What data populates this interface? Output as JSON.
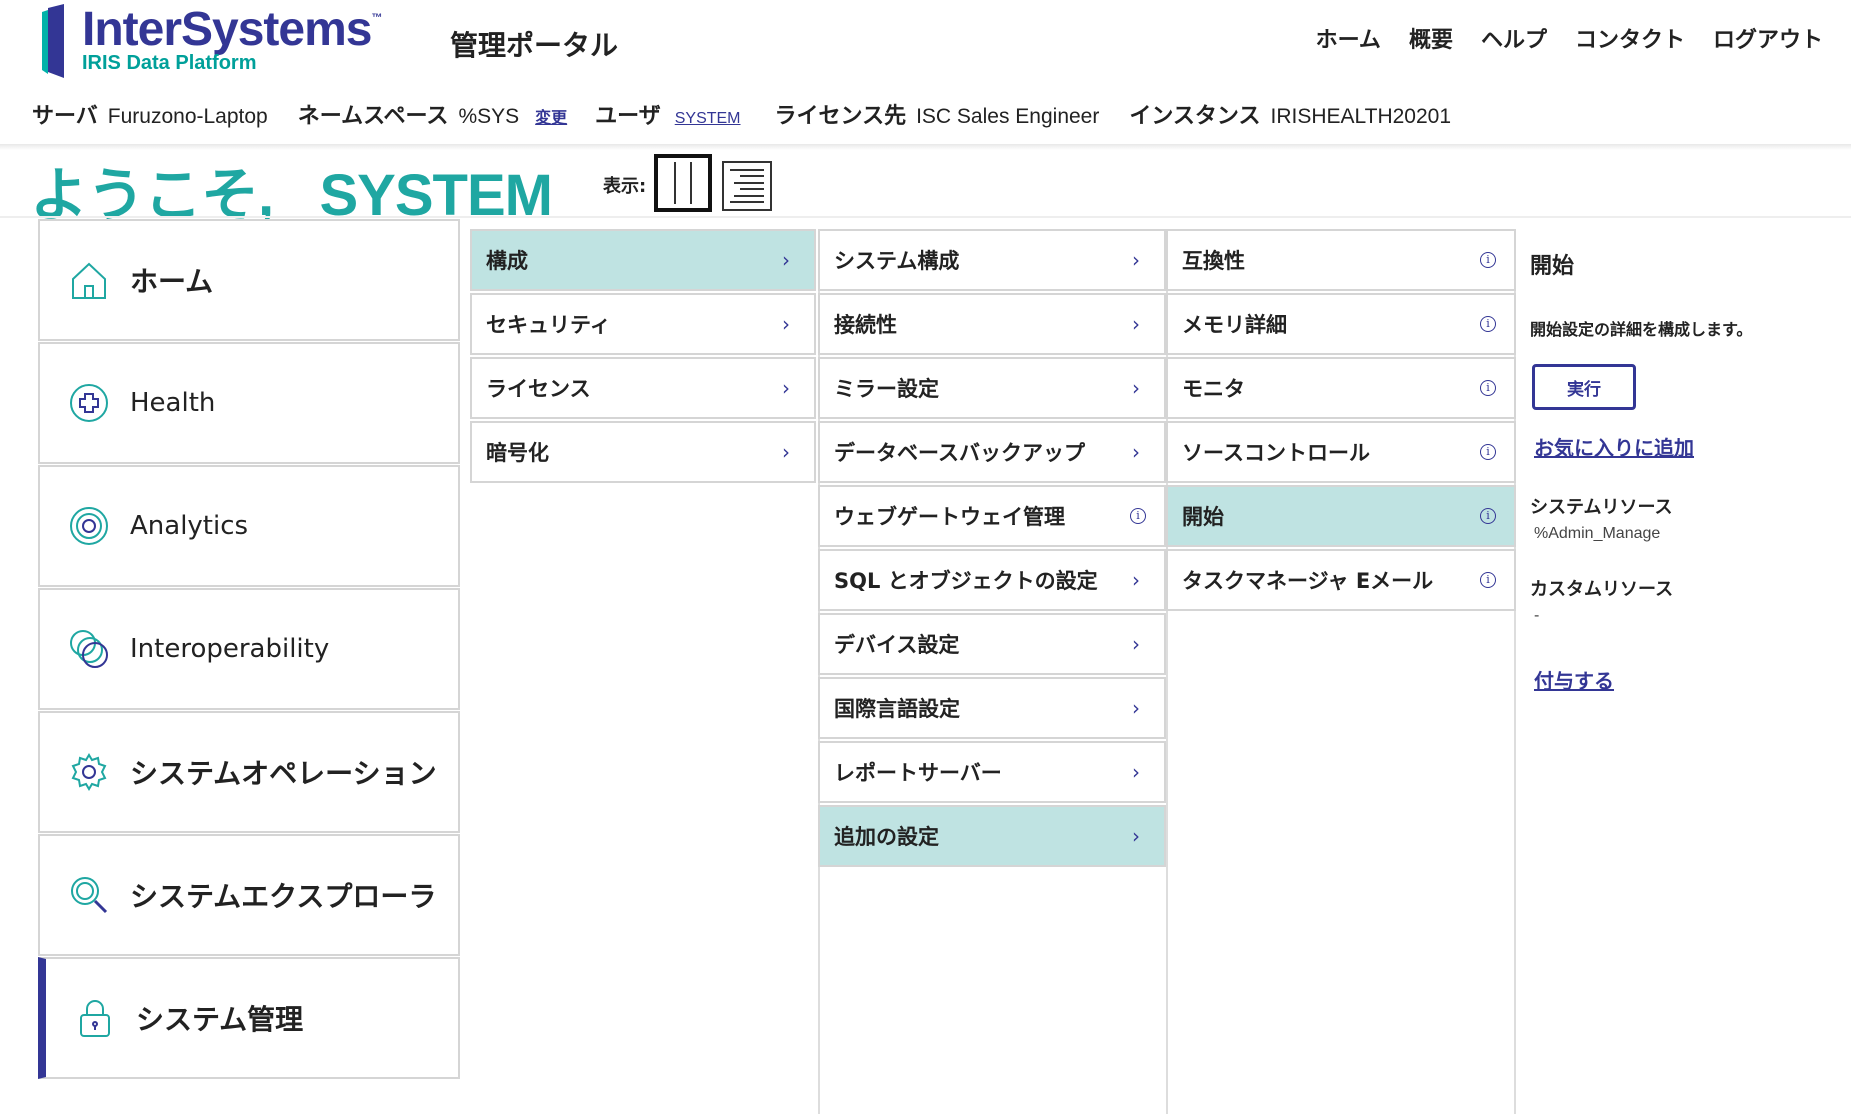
{
  "header": {
    "brand": "InterSystems",
    "brand_tm": "™",
    "brand_sub": "IRIS Data Platform",
    "portal_title": "管理ポータル",
    "nav": [
      "ホーム",
      "概要",
      "ヘルプ",
      "コンタクト",
      "ログアウト"
    ]
  },
  "info": {
    "server_label": "サーバ",
    "server_value": "Furuzono-Laptop",
    "namespace_label": "ネームスペース",
    "namespace_value": "%SYS",
    "change_link": "変更",
    "user_label": "ユーザ",
    "user_value": "SYSTEM",
    "license_label": "ライセンス先",
    "license_value": "ISC Sales Engineer",
    "instance_label": "インスタンス",
    "instance_value": "IRISHEALTH20201"
  },
  "welcome": "ようこそ, _SYSTEM",
  "view_label": "表示:",
  "colors": {
    "brand": "#333695",
    "teal": "#1fa7a2",
    "selected": "#bfe3e2"
  },
  "leftnav": [
    {
      "label": "ホーム",
      "icon": "home-icon"
    },
    {
      "label": "Health",
      "icon": "health-icon"
    },
    {
      "label": "Analytics",
      "icon": "analytics-icon"
    },
    {
      "label": "Interoperability",
      "icon": "interoperability-icon"
    },
    {
      "label": "システムオペレーション",
      "icon": "gear-icon"
    },
    {
      "label": "システムエクスプローラ",
      "icon": "magnifier-icon"
    },
    {
      "label": "システム管理",
      "icon": "lock-icon"
    }
  ],
  "col1": [
    "構成",
    "セキュリティ",
    "ライセンス",
    "暗号化"
  ],
  "col2": [
    "システム構成",
    "接続性",
    "ミラー設定",
    "データベースバックアップ",
    "ウェブゲートウェイ管理",
    "SQL とオブジェクトの設定",
    "デバイス設定",
    "国際言語設定",
    "レポートサーバー",
    "追加の設定"
  ],
  "col3": [
    "互換性",
    "メモリ詳細",
    "モニタ",
    "ソースコントロール",
    "開始",
    "タスクマネージャ Eメール"
  ],
  "detail": {
    "title": "開始",
    "description": "開始設定の詳細を構成します。",
    "run_button": "実行",
    "favorite_link": "お気に入りに追加",
    "sys_resource_label": "システムリソース",
    "sys_resource_value": "%Admin_Manage",
    "custom_resource_label": "カスタムリソース",
    "custom_resource_value": "-",
    "grant_link": "付与する"
  }
}
